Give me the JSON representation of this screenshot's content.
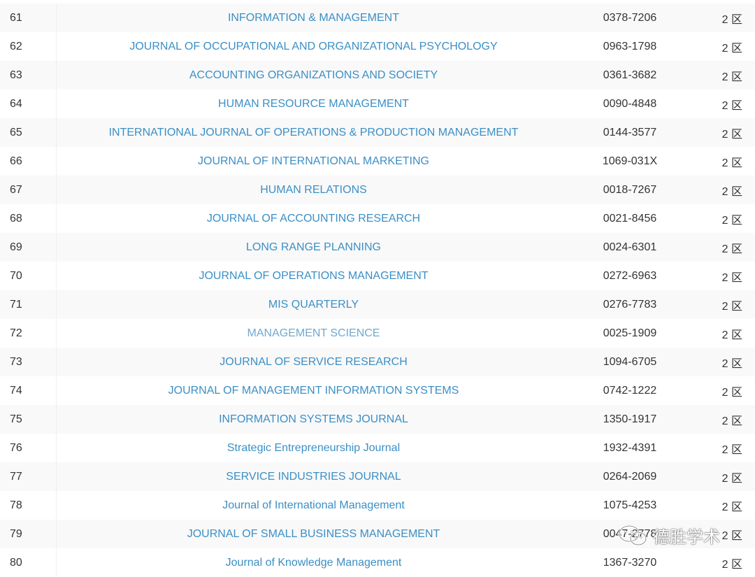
{
  "rows": [
    {
      "num": "61",
      "title": "INFORMATION & MANAGEMENT",
      "issn": "0378-7206",
      "zone": "2 区"
    },
    {
      "num": "62",
      "title": "JOURNAL OF OCCUPATIONAL AND ORGANIZATIONAL PSYCHOLOGY",
      "issn": "0963-1798",
      "zone": "2 区"
    },
    {
      "num": "63",
      "title": "ACCOUNTING ORGANIZATIONS AND SOCIETY",
      "issn": "0361-3682",
      "zone": "2 区"
    },
    {
      "num": "64",
      "title": "HUMAN RESOURCE MANAGEMENT",
      "issn": "0090-4848",
      "zone": "2 区"
    },
    {
      "num": "65",
      "title": "INTERNATIONAL JOURNAL OF OPERATIONS & PRODUCTION MANAGEMENT",
      "issn": "0144-3577",
      "zone": "2 区"
    },
    {
      "num": "66",
      "title": "JOURNAL OF INTERNATIONAL MARKETING",
      "issn": "1069-031X",
      "zone": "2 区"
    },
    {
      "num": "67",
      "title": "HUMAN RELATIONS",
      "issn": "0018-7267",
      "zone": "2 区"
    },
    {
      "num": "68",
      "title": "JOURNAL OF ACCOUNTING RESEARCH",
      "issn": "0021-8456",
      "zone": "2 区"
    },
    {
      "num": "69",
      "title": "LONG RANGE PLANNING",
      "issn": "0024-6301",
      "zone": "2 区"
    },
    {
      "num": "70",
      "title": "JOURNAL OF OPERATIONS MANAGEMENT",
      "issn": "0272-6963",
      "zone": "2 区"
    },
    {
      "num": "71",
      "title": "MIS QUARTERLY",
      "issn": "0276-7783",
      "zone": "2 区"
    },
    {
      "num": "72",
      "title": "MANAGEMENT SCIENCE",
      "issn": "0025-1909",
      "zone": "2 区",
      "light": true
    },
    {
      "num": "73",
      "title": "JOURNAL OF SERVICE RESEARCH",
      "issn": "1094-6705",
      "zone": "2 区"
    },
    {
      "num": "74",
      "title": "JOURNAL OF MANAGEMENT INFORMATION SYSTEMS",
      "issn": "0742-1222",
      "zone": "2 区"
    },
    {
      "num": "75",
      "title": "INFORMATION SYSTEMS JOURNAL",
      "issn": "1350-1917",
      "zone": "2 区"
    },
    {
      "num": "76",
      "title": "Strategic Entrepreneurship Journal",
      "issn": "1932-4391",
      "zone": "2 区"
    },
    {
      "num": "77",
      "title": "SERVICE INDUSTRIES JOURNAL",
      "issn": "0264-2069",
      "zone": "2 区"
    },
    {
      "num": "78",
      "title": "Journal of International Management",
      "issn": "1075-4253",
      "zone": "2 区"
    },
    {
      "num": "79",
      "title": "JOURNAL OF SMALL BUSINESS MANAGEMENT",
      "issn": "0047-2778",
      "zone": "2 区"
    },
    {
      "num": "80",
      "title": "Journal of Knowledge Management",
      "issn": "1367-3270",
      "zone": "2 区"
    }
  ],
  "watermark": {
    "text": "德胜学术",
    "icon": "wechat-icon"
  },
  "colors": {
    "link": "#3b8fc6",
    "link_light": "#6fa9d0",
    "stripe": "#f9f9f9",
    "text": "#333333"
  }
}
